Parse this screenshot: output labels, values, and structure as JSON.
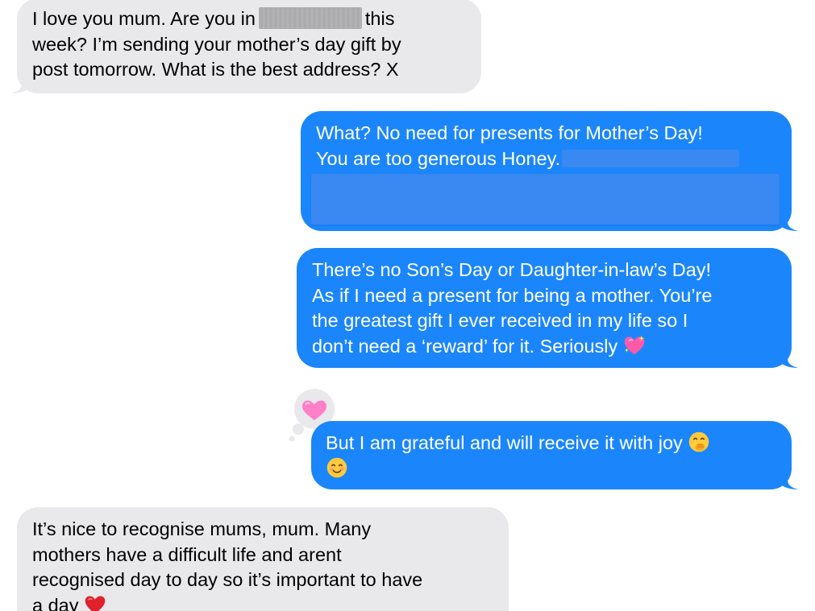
{
  "messages": [
    {
      "direction": "incoming",
      "lines": [
        {
          "before": "I love you mum. Are you in",
          "after": "this"
        },
        "week? I’m sending your mother’s day gift by",
        "post tomorrow. What is the best address? X"
      ]
    },
    {
      "direction": "outgoing",
      "lines": [
        "What? No need for presents for Mother’s Day!",
        "You are too generous Honey."
      ]
    },
    {
      "direction": "outgoing",
      "lines": [
        "There’s no Son’s Day or Daughter-in-law’s Day!",
        "As if I need a present for being a mother. You’re",
        "the greatest gift I ever received in my life so I",
        "don’t need a ‘reward’ for it. Seriously"
      ],
      "emoji": "sparkling-heart"
    },
    {
      "direction": "outgoing",
      "lines": [
        "But I am grateful and will receive it with joy"
      ],
      "emoji": [
        "face-with-hand-over-mouth",
        "smiling-face"
      ],
      "reaction": "pink-heart"
    },
    {
      "direction": "incoming",
      "lines": [
        "It’s nice to recognise mums, mum. Many",
        "mothers have a difficult life and arent",
        "recognised day to day so it’s important to have",
        "a day"
      ],
      "emoji": "red-heart"
    }
  ],
  "colors": {
    "incoming_bubble": "#e9e9eb",
    "outgoing_bubble": "#1b86fb",
    "incoming_text": "#000000",
    "outgoing_text": "#ffffff"
  }
}
